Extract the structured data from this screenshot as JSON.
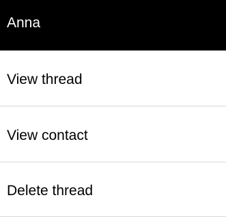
{
  "header": {
    "title": "Anna"
  },
  "menu": {
    "items": [
      {
        "label": "View thread"
      },
      {
        "label": "View contact"
      },
      {
        "label": "Delete thread"
      }
    ]
  },
  "colors": {
    "header_background": "#000000",
    "header_text": "#ffffff",
    "item_text": "#000000",
    "divider": "#d9d9d9",
    "background": "#ffffff"
  }
}
